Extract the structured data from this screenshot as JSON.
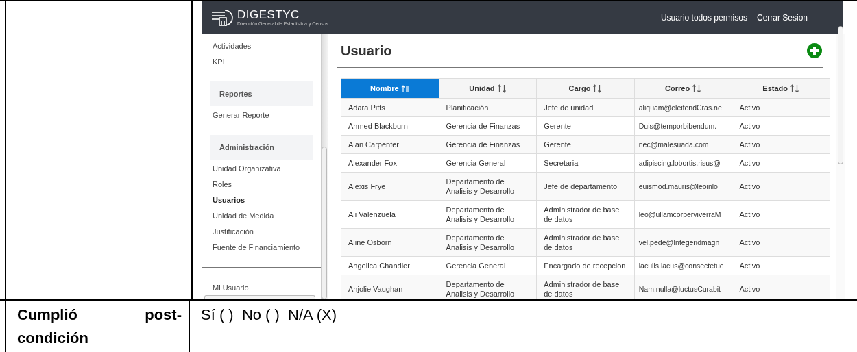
{
  "app": {
    "logo": {
      "name": "DIGESTYC",
      "subtitle": "Dirección General de Estadística y Censos"
    },
    "user_menu": [
      "Usuario todos permisos",
      "Cerrar Sesion"
    ],
    "sidebar": {
      "sections": [
        {
          "items": [
            {
              "label": "Actividades",
              "selected": false
            },
            {
              "label": "KPI",
              "selected": false
            }
          ]
        },
        {
          "title": "Reportes",
          "items": [
            {
              "label": "Generar Reporte",
              "selected": false
            }
          ]
        },
        {
          "title": "Administración",
          "items": [
            {
              "label": "Unidad Organizativa",
              "selected": false
            },
            {
              "label": "Roles",
              "selected": false
            },
            {
              "label": "Usuarios",
              "selected": true
            },
            {
              "label": "Unidad de Medida",
              "selected": false
            },
            {
              "label": "Justificación",
              "selected": false
            },
            {
              "label": "Fuente de Financiamiento",
              "selected": false
            }
          ]
        }
      ],
      "footer_items": [
        {
          "label": "Mi Usuario",
          "selected": false
        }
      ]
    },
    "page_title": "Usuario",
    "table": {
      "columns": [
        {
          "label": "Nombre",
          "selected": true
        },
        {
          "label": "Unidad",
          "selected": false
        },
        {
          "label": "Cargo",
          "selected": false
        },
        {
          "label": "Correo",
          "selected": false
        },
        {
          "label": "Estado",
          "selected": false
        }
      ],
      "rows": [
        [
          "Adara Pitts",
          "Planificación",
          "Jefe de unidad",
          "aliquam@eleifendCras.ne",
          "Activo"
        ],
        [
          "Ahmed Blackburn",
          "Gerencia de Finanzas",
          "Gerente",
          "Duis@temporbibendum.",
          "Activo"
        ],
        [
          "Alan Carpenter",
          "Gerencia de Finanzas",
          "Gerente",
          "nec@malesuada.com",
          "Activo"
        ],
        [
          "Alexander Fox",
          "Gerencia General",
          "Secretaria",
          "adipiscing.lobortis.risus@",
          "Activo"
        ],
        [
          "Alexis Frye",
          "Departamento de Analisis y Desarrollo",
          "Jefe de departamento",
          "euismod.mauris@leoinlo",
          "Activo"
        ],
        [
          "Ali Valenzuela",
          "Departamento de Analisis y Desarrollo",
          "Administrador de base de datos",
          "leo@ullamcorperviverraM",
          "Activo"
        ],
        [
          "Aline Osborn",
          "Departamento de Analisis y Desarrollo",
          "Administrador de base de datos",
          "vel.pede@Integeridmagn",
          "Activo"
        ],
        [
          "Angelica Chandler",
          "Gerencia General",
          "Encargado de recepcion",
          "iaculis.lacus@consectetue",
          "Activo"
        ],
        [
          "Anjolie Vaughan",
          "Departamento de Analisis y Desarrollo",
          "Administrador de base de datos",
          "Nam.nulla@luctusCurabit",
          "Activo"
        ]
      ]
    }
  },
  "postcondition": {
    "label": "Cumplió post-condición",
    "answer": "Sí ( )  No ( )  N/A (X)"
  }
}
